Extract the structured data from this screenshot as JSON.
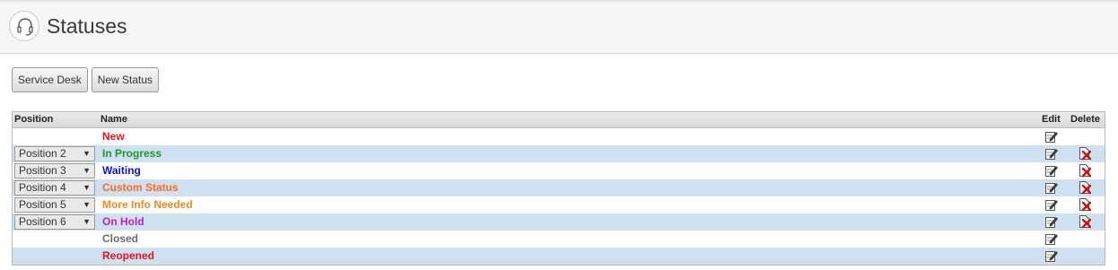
{
  "page": {
    "title": "Statuses",
    "logo_icon": "headset-icon"
  },
  "toolbar": {
    "service_desk_label": "Service Desk",
    "new_status_label": "New Status"
  },
  "grid": {
    "columns": {
      "position": "Position",
      "name": "Name",
      "edit": "Edit",
      "delete": "Delete"
    },
    "rows": [
      {
        "position": "",
        "name": "New",
        "color": "#e8141b",
        "deletable": false
      },
      {
        "position": "Position 2",
        "name": "In Progress",
        "color": "#1a9a2a",
        "deletable": true
      },
      {
        "position": "Position 3",
        "name": "Waiting",
        "color": "#1010d0",
        "deletable": true
      },
      {
        "position": "Position 4",
        "name": "Custom Status",
        "color": "#ff6a1f",
        "deletable": true
      },
      {
        "position": "Position 5",
        "name": "More Info Needed",
        "color": "#f08a1c",
        "deletable": true
      },
      {
        "position": "Position 6",
        "name": "On Hold",
        "color": "#c020c0",
        "deletable": true
      },
      {
        "position": "",
        "name": "Closed",
        "color": "#6b6b6b",
        "deletable": false
      },
      {
        "position": "",
        "name": "Reopened",
        "color": "#e8141b",
        "deletable": false
      }
    ]
  }
}
